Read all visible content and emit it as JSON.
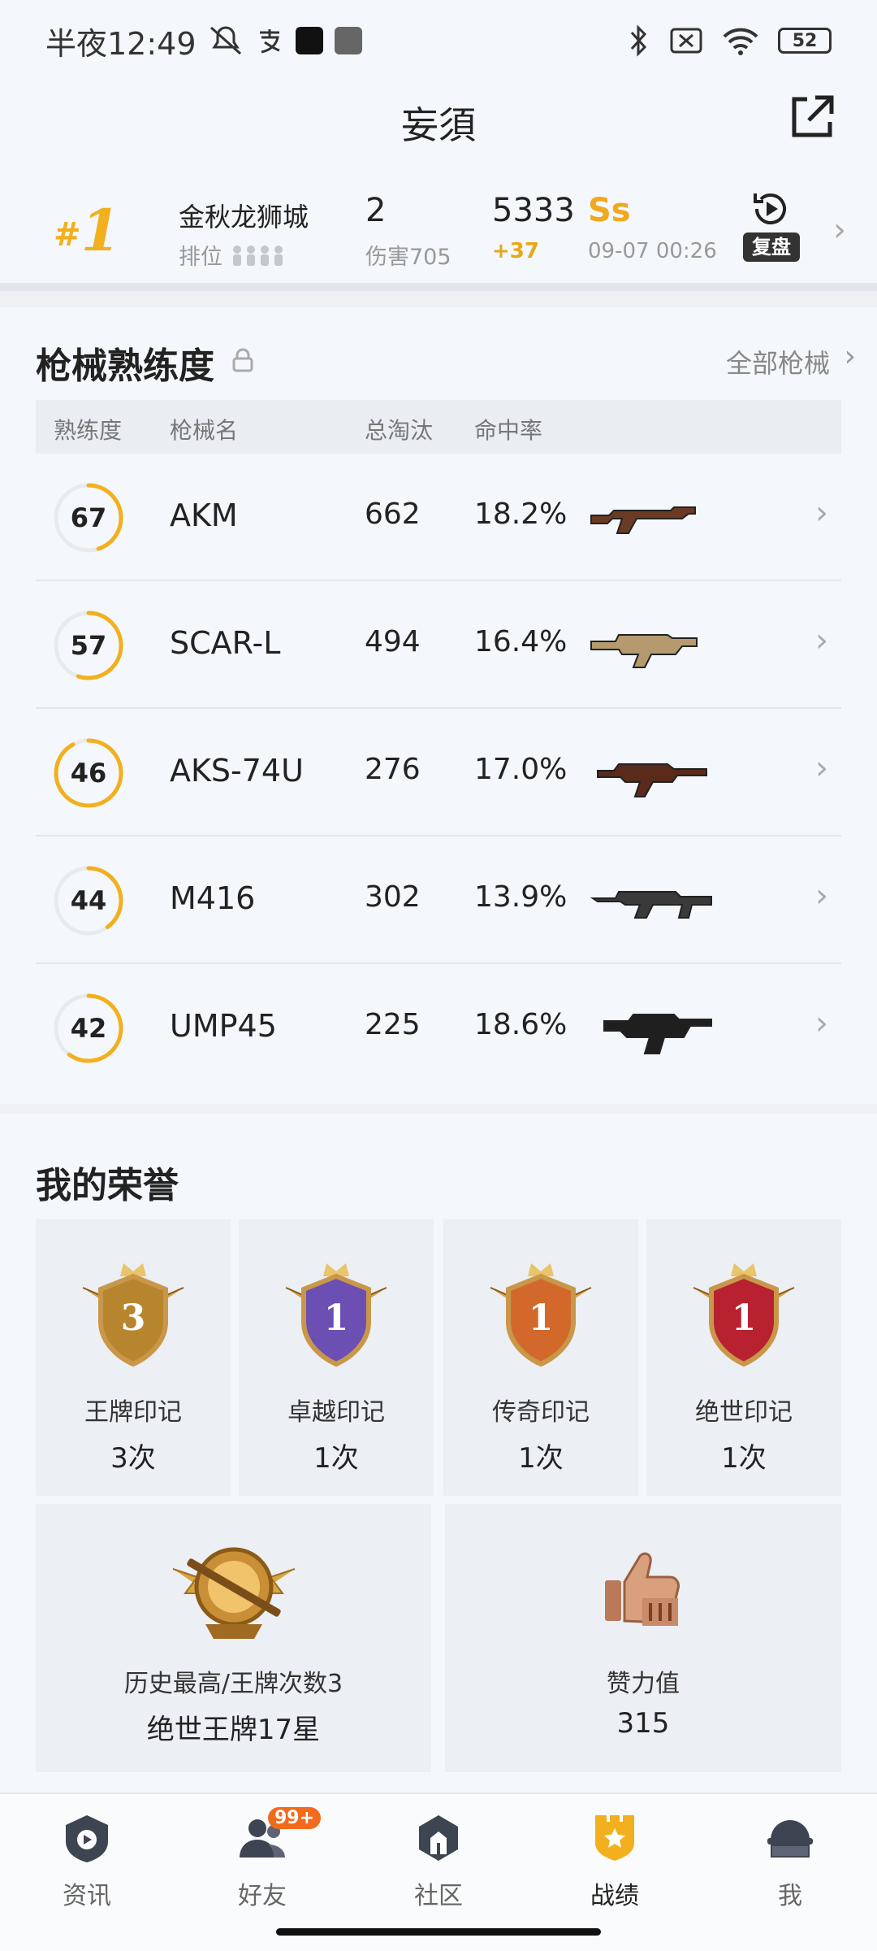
{
  "status_bar": {
    "time": "半夜12:49",
    "battery": "52"
  },
  "header": {
    "title": "妄須"
  },
  "recent_match": {
    "rank": "1",
    "player_name": "金秋龙狮城",
    "mode": "排位",
    "kills": "2",
    "damage": "伤害705",
    "score": "5333",
    "score_delta": "+37",
    "tier": "Ss",
    "time": "09-07 00:26",
    "replay_label": "复盘"
  },
  "weapons": {
    "title": "枪械熟练度",
    "all_link": "全部枪械",
    "columns": {
      "proficiency": "熟练度",
      "name": "枪械名",
      "kills": "总淘汰",
      "accuracy": "命中率"
    },
    "rows": [
      {
        "level": "67",
        "name": "AKM",
        "kills": "662",
        "accuracy": "18.2%",
        "progress": 0.45,
        "gun_color": "#6b3a22"
      },
      {
        "level": "57",
        "name": "SCAR-L",
        "kills": "494",
        "accuracy": "16.4%",
        "progress": 0.55,
        "gun_color": "#b49a6e"
      },
      {
        "level": "46",
        "name": "AKS-74U",
        "kills": "276",
        "accuracy": "17.0%",
        "progress": 0.92,
        "gun_color": "#5a2a1a"
      },
      {
        "level": "44",
        "name": "M416",
        "kills": "302",
        "accuracy": "13.9%",
        "progress": 0.4,
        "gun_color": "#3a3a3a"
      },
      {
        "level": "42",
        "name": "UMP45",
        "kills": "225",
        "accuracy": "18.6%",
        "progress": 0.6,
        "gun_color": "#1f1f1f"
      }
    ]
  },
  "honor": {
    "title": "我的荣誉",
    "items": [
      {
        "label": "王牌印记",
        "value": "3次",
        "medal_number": "3",
        "color": "#b8852f"
      },
      {
        "label": "卓越印记",
        "value": "1次",
        "medal_number": "1",
        "color": "#6b4fb3"
      },
      {
        "label": "传奇印记",
        "value": "1次",
        "medal_number": "1",
        "color": "#d2692a"
      },
      {
        "label": "绝世印记",
        "value": "1次",
        "medal_number": "1",
        "color": "#b8212f"
      }
    ],
    "history": {
      "label": "历史最高/王牌次数3",
      "value": "绝世王牌17星"
    },
    "likes": {
      "label": "赞力值",
      "value": "315"
    }
  },
  "bottom_nav": {
    "items": [
      {
        "label": "资讯",
        "icon": "news-icon"
      },
      {
        "label": "好友",
        "icon": "friends-icon",
        "badge": "99+"
      },
      {
        "label": "社区",
        "icon": "community-icon"
      },
      {
        "label": "战绩",
        "icon": "stats-icon",
        "active": true
      },
      {
        "label": "我",
        "icon": "profile-icon"
      }
    ]
  },
  "colors": {
    "accent": "#f2b01e",
    "text": "#222222",
    "muted": "#999999"
  }
}
